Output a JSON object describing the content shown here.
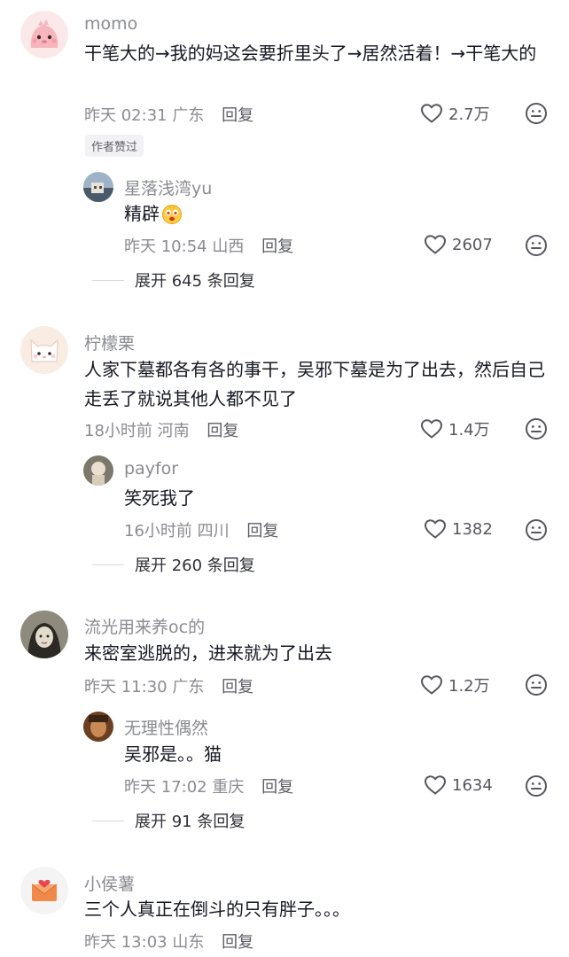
{
  "comments": [
    {
      "username": "momo",
      "text": "干笔大的→我的妈这会要折里头了→居然活着！→干笔大的",
      "time": "昨天 02:31",
      "location": "广东",
      "reply_label": "回复",
      "likes": "2.7万",
      "badge": "作者赞过",
      "avatar_icon": "pink-monster-avatar",
      "replies": [
        {
          "username": "星落浅湾yu",
          "text": "精辟",
          "emoji": "bubbly-face-emoji",
          "time": "昨天 10:54",
          "location": "山西",
          "reply_label": "回复",
          "likes": "2607"
        }
      ],
      "expand_label": "展开 645 条回复"
    },
    {
      "username": "柠檬栗",
      "text": "人家下墓都各有各的事干，吴邪下墓是为了出去，然后自己走丢了就说其他人都不见了",
      "time": "18小时前",
      "location": "河南",
      "reply_label": "回复",
      "likes": "1.4万",
      "avatar_icon": "white-cat-avatar",
      "replies": [
        {
          "username": "payfor",
          "text": "笑死我了",
          "time": "16小时前",
          "location": "四川",
          "reply_label": "回复",
          "likes": "1382"
        }
      ],
      "expand_label": "展开 260 条回复"
    },
    {
      "username": "流光用来养oc的",
      "text": "来密室逃脱的，进来就为了出去",
      "time": "昨天 11:30",
      "location": "广东",
      "reply_label": "回复",
      "likes": "1.2万",
      "avatar_icon": "anime-character-avatar",
      "replies": [
        {
          "username": "无理性偶然",
          "text": "吴邪是。。猫",
          "time": "昨天 17:02",
          "location": "重庆",
          "reply_label": "回复",
          "likes": "1634"
        }
      ],
      "expand_label": "展开 91 条回复"
    },
    {
      "username": "小侯薯",
      "text": "三个人真正在倒斗的只有胖子。。。",
      "time": "昨天 13:03",
      "location": "山东",
      "reply_label": "回复",
      "avatar_icon": "envelope-heart-avatar"
    }
  ],
  "colors": {
    "name": "#8a8b91",
    "text": "#161823",
    "meta": "#8a8b91",
    "background": "#ffffff"
  }
}
